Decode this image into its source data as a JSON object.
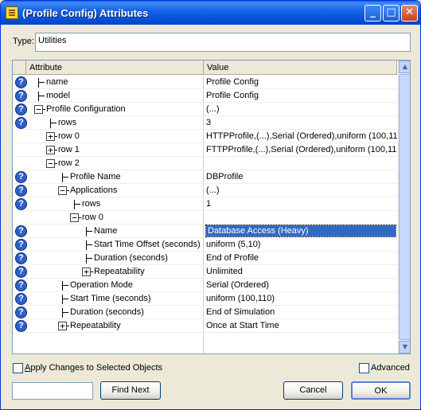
{
  "window": {
    "title": "(Profile Config) Attributes",
    "controls": {
      "minimize": "_",
      "maximize": "□",
      "close": "✕"
    }
  },
  "type_field": {
    "label": "Type:",
    "value": "Utilities"
  },
  "table": {
    "columns": [
      "Attribute",
      "Value"
    ],
    "rows": [
      {
        "help": true,
        "expander": "",
        "label": "name",
        "value": "Profile Config"
      },
      {
        "help": true,
        "expander": "",
        "label": "model",
        "value": "Profile Config"
      },
      {
        "help": true,
        "expander": "−",
        "label": "Profile Configuration",
        "value": "(...)"
      },
      {
        "help": true,
        "expander": "",
        "label": "rows",
        "value": "3"
      },
      {
        "help": false,
        "expander": "+",
        "label": "row 0",
        "value": "HTTPProfile,(...),Serial (Ordered),uniform (100,11..."
      },
      {
        "help": false,
        "expander": "+",
        "label": "row 1",
        "value": "FTTPProfile,(...),Serial (Ordered),uniform (100,11..."
      },
      {
        "help": false,
        "expander": "−",
        "label": "row 2",
        "value": ""
      },
      {
        "help": true,
        "expander": "",
        "label": "Profile Name",
        "value": "DBProfile"
      },
      {
        "help": true,
        "expander": "−",
        "label": "Applications",
        "value": "(...)"
      },
      {
        "help": true,
        "expander": "",
        "label": "rows",
        "value": "1"
      },
      {
        "help": false,
        "expander": "−",
        "label": "row 0",
        "value": ""
      },
      {
        "help": true,
        "expander": "",
        "label": "Name",
        "value": "Database Access (Heavy)",
        "selected": true
      },
      {
        "help": true,
        "expander": "",
        "label": "Start Time Offset (seconds)",
        "value": "uniform (5,10)"
      },
      {
        "help": true,
        "expander": "",
        "label": "Duration (seconds)",
        "value": "End of Profile"
      },
      {
        "help": true,
        "expander": "+",
        "label": "Repeatability",
        "value": "Unlimited"
      },
      {
        "help": true,
        "expander": "",
        "label": "Operation Mode",
        "value": "Serial (Ordered)"
      },
      {
        "help": true,
        "expander": "",
        "label": "Start Time (seconds)",
        "value": "uniform (100,110)"
      },
      {
        "help": true,
        "expander": "",
        "label": "Duration (seconds)",
        "value": "End of Simulation"
      },
      {
        "help": true,
        "expander": "+",
        "label": "Repeatability",
        "value": "Once at Start Time"
      }
    ]
  },
  "footer": {
    "apply_changes": {
      "label": "Apply Changes to Selected Objects",
      "checked": false
    },
    "advanced": {
      "label": "Advanced",
      "checked": false
    },
    "search_value": "",
    "find_next": "Find Next",
    "cancel": "Cancel",
    "ok": "OK"
  },
  "colors": {
    "titlebar": "#0350D6",
    "selection": "#316AC5",
    "window_bg": "#ECE9D8"
  }
}
